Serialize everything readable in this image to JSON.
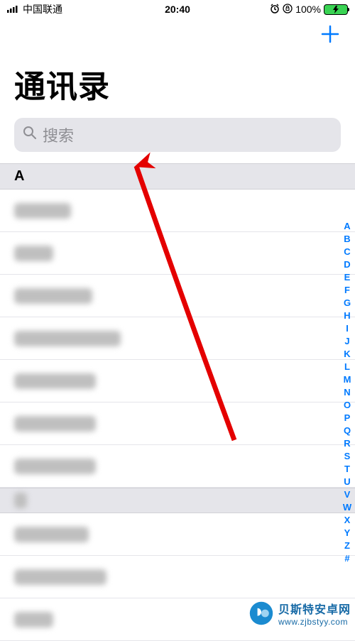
{
  "status": {
    "carrier": "中国联通",
    "time": "20:40",
    "battery_pct": "100%"
  },
  "header": {
    "title": "通讯录"
  },
  "search": {
    "placeholder": "搜索"
  },
  "sections": [
    {
      "letter": "A",
      "rows": [
        80,
        55,
        110,
        150,
        115,
        115,
        115
      ]
    },
    {
      "letter": "B",
      "rows": [
        105,
        130,
        55
      ]
    }
  ],
  "index_letters": [
    "A",
    "B",
    "C",
    "D",
    "E",
    "F",
    "G",
    "H",
    "I",
    "J",
    "K",
    "L",
    "M",
    "N",
    "O",
    "P",
    "Q",
    "R",
    "S",
    "T",
    "U",
    "V",
    "W",
    "X",
    "Y",
    "Z",
    "#"
  ],
  "watermark": {
    "line1": "贝斯特安卓网",
    "line2": "www.zjbstyy.com"
  }
}
